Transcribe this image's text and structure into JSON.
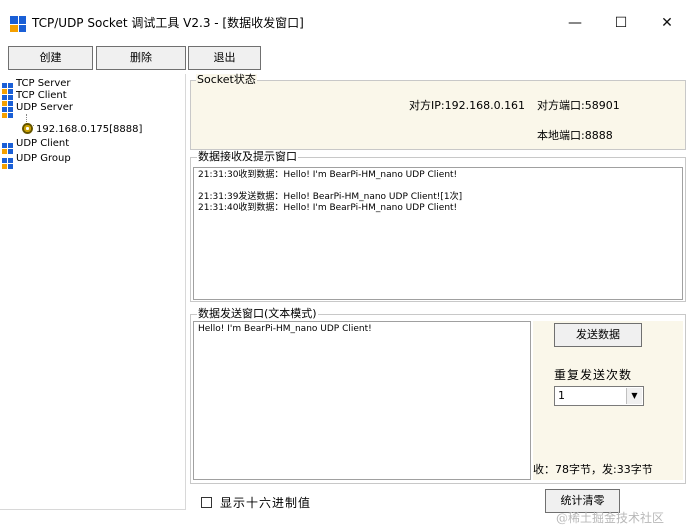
{
  "window": {
    "title": "TCP/UDP Socket 调试工具 V2.3 - [数据收发窗口]",
    "minimize_glyph": "—",
    "maximize_glyph": "☐",
    "close_glyph": "✕"
  },
  "toolbar": {
    "create_label": "创建",
    "delete_label": "删除",
    "exit_label": "退出"
  },
  "tree": {
    "items": [
      {
        "label": "TCP Server"
      },
      {
        "label": "TCP Client"
      },
      {
        "label": "UDP Server"
      },
      {
        "label": "UDP Client"
      },
      {
        "label": "UDP Group"
      }
    ],
    "udp_server_child": "192.168.0.175[8888]"
  },
  "socket_status": {
    "group_title": "Socket状态",
    "peer_ip": "对方IP:192.168.0.161",
    "peer_port": "对方端口:58901",
    "local_port": "本地端口:8888"
  },
  "receive": {
    "group_title": "数据接收及提示窗口",
    "lines": [
      "21:31:30收到数据：Hello! I'm BearPi-HM_nano UDP Client!",
      "",
      "21:31:39发送数据：Hello! BearPi-HM_nano UDP Client![1次]",
      "21:31:40收到数据：Hello! I'm BearPi-HM_nano UDP Client!"
    ]
  },
  "send": {
    "group_title": "数据发送窗口(文本模式)",
    "content": "Hello! I'm BearPi-HM_nano UDP Client!",
    "send_button": "发送数据",
    "repeat_label": "重复发送次数",
    "repeat_value": "1",
    "stats": "收：78字节，发:33字节"
  },
  "bottom": {
    "hex_label": "显示十六进制值",
    "clear_button": "统计清零",
    "watermark": "@稀土掘金技术社区"
  },
  "colors": {
    "icon_blue": "#1a5fd6",
    "icon_orange": "#f5a000",
    "panel_bg": "#faf7ea"
  }
}
